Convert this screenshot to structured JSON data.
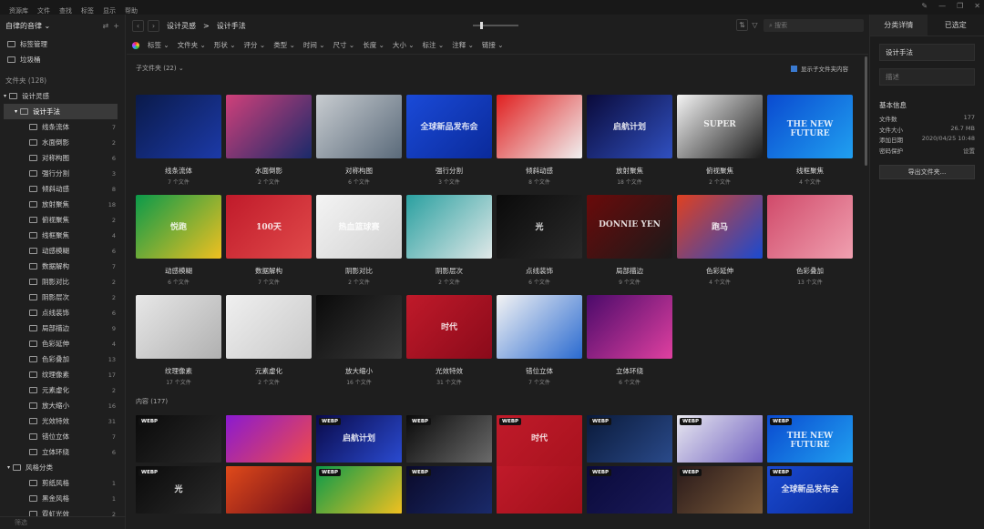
{
  "menu": [
    "资源库",
    "文件",
    "查找",
    "标签",
    "显示",
    "帮助"
  ],
  "library": {
    "title": "自律的音律 ⌄"
  },
  "sidebar": {
    "tag_mgmt": "标签管理",
    "trash": "垃圾桶",
    "folders_label": "文件夹 (128)",
    "root": "设计灵感",
    "sel": "设计手法",
    "children": [
      {
        "label": "线条流体",
        "count": "7"
      },
      {
        "label": "水面倒影",
        "count": "2"
      },
      {
        "label": "对称构图",
        "count": "6"
      },
      {
        "label": "强行分割",
        "count": "3"
      },
      {
        "label": "倾斜动感",
        "count": "8"
      },
      {
        "label": "放射聚焦",
        "count": "18"
      },
      {
        "label": "俯视聚焦",
        "count": "2"
      },
      {
        "label": "线框聚焦",
        "count": "4"
      },
      {
        "label": "动感模糊",
        "count": "6"
      },
      {
        "label": "数据解构",
        "count": "7"
      },
      {
        "label": "阴影对比",
        "count": "2"
      },
      {
        "label": "阴影层次",
        "count": "2"
      },
      {
        "label": "点线装饰",
        "count": "6"
      },
      {
        "label": "局部描边",
        "count": "9"
      },
      {
        "label": "色彩延伸",
        "count": "4"
      },
      {
        "label": "色彩叠加",
        "count": "13"
      },
      {
        "label": "纹理像素",
        "count": "17"
      },
      {
        "label": "元素虚化",
        "count": "2"
      },
      {
        "label": "放大缩小",
        "count": "16"
      },
      {
        "label": "光效特效",
        "count": "31"
      },
      {
        "label": "错位立体",
        "count": "7"
      },
      {
        "label": "立体环绕",
        "count": "6"
      }
    ],
    "cat": "风格分类",
    "sub": [
      {
        "label": "剪纸风格",
        "count": "1"
      },
      {
        "label": "黑金风格",
        "count": "1"
      },
      {
        "label": "霓虹光效",
        "count": "2"
      }
    ],
    "filter_placeholder": "筛选"
  },
  "toolbar": {
    "crumb1": "设计灵感",
    "sep": ">",
    "crumb2": "设计手法",
    "search_placeholder": "搜索"
  },
  "filters": [
    "标签 ⌄",
    "文件夹 ⌄",
    "形状 ⌄",
    "评分 ⌄",
    "类型 ⌄",
    "时间 ⌄",
    "尺寸 ⌄",
    "长度 ⌄",
    "大小 ⌄",
    "标注 ⌄",
    "注释 ⌄",
    "链接 ⌄"
  ],
  "subfolder_label": "子文件夹 (22) ⌄",
  "show_sub": "显示子文件夹内容",
  "content_label": "内容 (177)",
  "cards": [
    {
      "name": "线条流体",
      "count": "7 个文件",
      "c1": "#0a1a4a",
      "c2": "#1c3aa8",
      "t": ""
    },
    {
      "name": "水面倒影",
      "count": "2 个文件",
      "c1": "#d0407a",
      "c2": "#1a2a6a",
      "t": ""
    },
    {
      "name": "对称构图",
      "count": "6 个文件",
      "c1": "#c8ccd0",
      "c2": "#5a6a7a",
      "t": ""
    },
    {
      "name": "强行分割",
      "count": "3 个文件",
      "c1": "#1a4ad8",
      "c2": "#0a2a9a",
      "t": "全球新品发布会"
    },
    {
      "name": "倾斜动感",
      "count": "8 个文件",
      "c1": "#e02020",
      "c2": "#f0f0f0",
      "t": ""
    },
    {
      "name": "放射聚焦",
      "count": "18 个文件",
      "c1": "#0a0a3a",
      "c2": "#3050c0",
      "t": "启航计划"
    },
    {
      "name": "俯视聚焦",
      "count": "2 个文件",
      "c1": "#f4f4f4",
      "c2": "#1a1a1a",
      "t": "SUPER"
    },
    {
      "name": "线框聚焦",
      "count": "4 个文件",
      "c1": "#0a4ad0",
      "c2": "#20a0f0",
      "t": "THE NEW FUTURE"
    },
    {
      "name": "动感模糊",
      "count": "6 个文件",
      "c1": "#0a9a4a",
      "c2": "#f0c020",
      "t": "悦跑"
    },
    {
      "name": "数据解构",
      "count": "7 个文件",
      "c1": "#c01a2a",
      "c2": "#e04a4a",
      "t": "100天"
    },
    {
      "name": "阴影对比",
      "count": "2 个文件",
      "c1": "#f4f4f4",
      "c2": "#d0d0d0",
      "t": "热血篮球赛"
    },
    {
      "name": "阴影层次",
      "count": "2 个文件",
      "c1": "#2aa0a0",
      "c2": "#e0e8e8",
      "t": ""
    },
    {
      "name": "点线装饰",
      "count": "6 个文件",
      "c1": "#0a0a0a",
      "c2": "#2a2a2a",
      "t": "光"
    },
    {
      "name": "局部描边",
      "count": "9 个文件",
      "c1": "#6a0a0a",
      "c2": "#1a1a1a",
      "t": "DONNIE YEN"
    },
    {
      "name": "色彩延伸",
      "count": "4 个文件",
      "c1": "#e04020",
      "c2": "#1a4ad0",
      "t": "跑马"
    },
    {
      "name": "色彩叠加",
      "count": "13 个文件",
      "c1": "#d04a6a",
      "c2": "#f0a0b0",
      "t": ""
    },
    {
      "name": "纹理像素",
      "count": "17 个文件",
      "c1": "#e8e8e8",
      "c2": "#b0b0b0",
      "t": ""
    },
    {
      "name": "元素虚化",
      "count": "2 个文件",
      "c1": "#f0f0f0",
      "c2": "#c8c8c8",
      "t": ""
    },
    {
      "name": "放大缩小",
      "count": "16 个文件",
      "c1": "#0a0a0a",
      "c2": "#3a3a3a",
      "t": ""
    },
    {
      "name": "光效特效",
      "count": "31 个文件",
      "c1": "#c01a2a",
      "c2": "#8a0a1a",
      "t": "时代"
    },
    {
      "name": "错位立体",
      "count": "7 个文件",
      "c1": "#f4f4f4",
      "c2": "#2a6ad0",
      "t": ""
    },
    {
      "name": "立体环绕",
      "count": "6 个文件",
      "c1": "#4a0a6a",
      "c2": "#e040a0",
      "t": ""
    }
  ],
  "items": [
    {
      "c1": "#0a0a0a",
      "c2": "#2a2a2a",
      "t": "",
      "badge": "WEBP"
    },
    {
      "c1": "#8a1ad0",
      "c2": "#f04a4a",
      "t": "",
      "badge": ""
    },
    {
      "c1": "#0a0a4a",
      "c2": "#2a4ad0",
      "t": "启航计划",
      "badge": "WEBP"
    },
    {
      "c1": "#0a0a0a",
      "c2": "#6a6a6a",
      "t": "",
      "badge": "WEBP"
    },
    {
      "c1": "#c01a2a",
      "c2": "#a0101a",
      "t": "时代",
      "badge": "WEBP"
    },
    {
      "c1": "#0a1a3a",
      "c2": "#2a4a8a",
      "t": "",
      "badge": "WEBP"
    },
    {
      "c1": "#e8e8f0",
      "c2": "#7060c0",
      "t": "",
      "badge": "WEBP"
    },
    {
      "c1": "#0a4ad0",
      "c2": "#20a0f0",
      "t": "THE NEW FUTURE",
      "badge": "WEBP"
    },
    {
      "c1": "#0a0a0a",
      "c2": "#2a2a2a",
      "t": "光",
      "badge": "WEBP"
    },
    {
      "c1": "#e04a1a",
      "c2": "#6a0a1a",
      "t": "",
      "badge": ""
    },
    {
      "c1": "#0a9a4a",
      "c2": "#f0c020",
      "t": "",
      "badge": "WEBP"
    },
    {
      "c1": "#0a0a2a",
      "c2": "#1a2a6a",
      "t": "",
      "badge": "WEBP"
    },
    {
      "c1": "#c01a2a",
      "c2": "#a0101a",
      "t": "",
      "badge": ""
    },
    {
      "c1": "#0a0a3a",
      "c2": "#1a1a5a",
      "t": "",
      "badge": "WEBP"
    },
    {
      "c1": "#2a1a1a",
      "c2": "#7a5a3a",
      "t": "",
      "badge": "WEBP"
    },
    {
      "c1": "#1a4ad0",
      "c2": "#0a2a9a",
      "t": "全球新品发布会",
      "badge": "WEBP"
    }
  ],
  "detail": {
    "tab1": "分类详情",
    "tab2": "已选定",
    "name": "设计手法",
    "desc_placeholder": "描述",
    "basic": "基本信息",
    "rows": [
      {
        "k": "文件数",
        "v": "177"
      },
      {
        "k": "文件大小",
        "v": "26.7 MB"
      },
      {
        "k": "添加日期",
        "v": "2020/04/25 10:48"
      },
      {
        "k": "密码保护",
        "v": "设置"
      }
    ],
    "export": "导出文件夹..."
  }
}
